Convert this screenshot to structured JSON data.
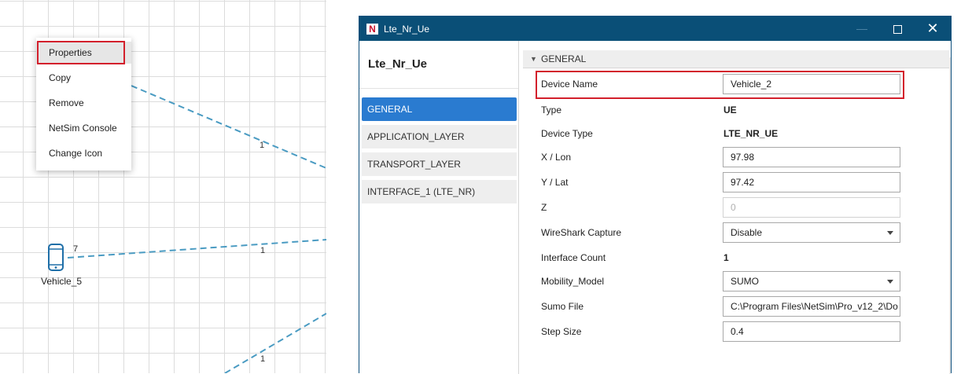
{
  "canvas": {
    "link_labels": [
      "1",
      "1",
      "1"
    ],
    "device": {
      "id": "7",
      "name": "Vehicle_5",
      "icon": "phone-icon"
    },
    "accent_link_color": "#4a9bc2"
  },
  "context_menu": {
    "items": [
      {
        "label": "Properties",
        "active": true
      },
      {
        "label": "Copy"
      },
      {
        "label": "Remove"
      },
      {
        "label": "NetSim Console"
      },
      {
        "label": "Change Icon"
      }
    ]
  },
  "dialog": {
    "title": "Lte_Nr_Ue",
    "logo_letter": "N",
    "controls": {
      "minimize": "—",
      "maximize": "maximize-icon",
      "close": "✕"
    },
    "colors": {
      "titlebar": "#0a4f77",
      "active_tab": "#2a7bd0",
      "highlight": "#d3202c"
    },
    "sidebar": {
      "title": "Lte_Nr_Ue",
      "items": [
        {
          "label": "GENERAL",
          "active": true
        },
        {
          "label": "APPLICATION_LAYER"
        },
        {
          "label": "TRANSPORT_LAYER"
        },
        {
          "label": "INTERFACE_1 (LTE_NR)"
        }
      ]
    },
    "section": {
      "title": "GENERAL",
      "expanded": true
    },
    "properties": {
      "device_name": {
        "label": "Device Name",
        "value": "Vehicle_2"
      },
      "type": {
        "label": "Type",
        "value": "UE"
      },
      "device_type": {
        "label": "Device Type",
        "value": "LTE_NR_UE"
      },
      "x_lon": {
        "label": "X / Lon",
        "value": "97.98"
      },
      "y_lat": {
        "label": "Y / Lat",
        "value": "97.42"
      },
      "z": {
        "label": "Z",
        "value": "0"
      },
      "wireshark": {
        "label": "WireShark Capture",
        "value": "Disable"
      },
      "interface_count": {
        "label": "Interface Count",
        "value": "1"
      },
      "mobility_model": {
        "label": "Mobility_Model",
        "value": "SUMO"
      },
      "sumo_file": {
        "label": "Sumo File",
        "value": "C:\\Program Files\\NetSim\\Pro_v12_2\\Do"
      },
      "step_size": {
        "label": "Step Size",
        "value": "0.4"
      }
    }
  }
}
